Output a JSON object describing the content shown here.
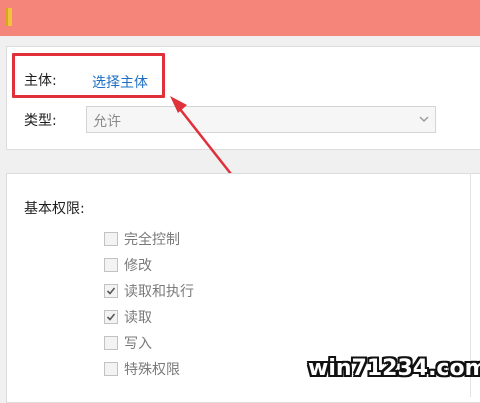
{
  "principal": {
    "label": "主体:",
    "link": "选择主体"
  },
  "type": {
    "label": "类型:",
    "value": "允许"
  },
  "permissions": {
    "heading": "基本权限:",
    "items": [
      {
        "label": "完全控制",
        "checked": false
      },
      {
        "label": "修改",
        "checked": false
      },
      {
        "label": "读取和执行",
        "checked": true
      },
      {
        "label": "读取",
        "checked": true
      },
      {
        "label": "写入",
        "checked": false
      },
      {
        "label": "特殊权限",
        "checked": false
      }
    ]
  },
  "watermark": "win71234.com",
  "colors": {
    "titlebar": "#f5857a",
    "highlight": "#e0303a",
    "link": "#1f6fc4"
  }
}
